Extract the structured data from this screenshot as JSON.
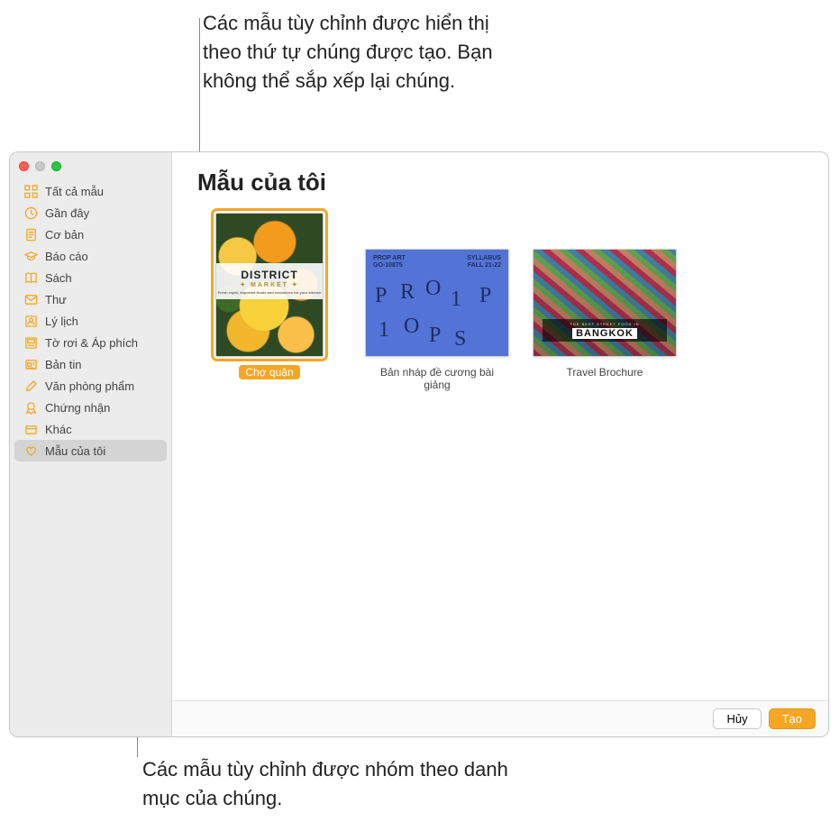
{
  "annotations": {
    "top": "Các mẫu tùy chỉnh được hiển thị theo thứ tự chúng được tạo. Bạn không thể sắp xếp lại chúng.",
    "bottom": "Các mẫu tùy chỉnh được nhóm theo danh mục của chúng."
  },
  "sidebar": {
    "items": [
      {
        "label": "Tất cả mẫu",
        "icon": "grid-icon"
      },
      {
        "label": "Gần đây",
        "icon": "clock-icon"
      },
      {
        "label": "Cơ bản",
        "icon": "doc-icon"
      },
      {
        "label": "Báo cáo",
        "icon": "gradcap-icon"
      },
      {
        "label": "Sách",
        "icon": "book-icon"
      },
      {
        "label": "Thư",
        "icon": "envelope-icon"
      },
      {
        "label": "Lý lịch",
        "icon": "person-icon"
      },
      {
        "label": "Tờ rơi & Áp phích",
        "icon": "poster-icon"
      },
      {
        "label": "Bản tin",
        "icon": "newspaper-icon"
      },
      {
        "label": "Văn phòng phẩm",
        "icon": "pen-icon"
      },
      {
        "label": "Chứng nhận",
        "icon": "ribbon-icon"
      },
      {
        "label": "Khác",
        "icon": "misc-icon"
      },
      {
        "label": "Mẫu của tôi",
        "icon": "heart-icon",
        "selected": true
      }
    ]
  },
  "main": {
    "title": "Mẫu của tôi",
    "templates": [
      {
        "label": "Chợ quận",
        "kind": "district",
        "selected": true,
        "thumb": {
          "line1": "DISTRICT",
          "line2": "MARKET",
          "line3": "Fresh explo, imported foods and exclusives for your kitchen"
        }
      },
      {
        "label": "Bản nháp đề cương bài giảng",
        "kind": "props",
        "landscape": true,
        "thumb": {
          "topLeftA": "PROP ART",
          "topLeftB": "GO-10875",
          "topRightA": "SYLLABUS",
          "topRightB": "FALL 21-22",
          "letters": [
            "P",
            "R",
            "O",
            "1",
            "P",
            "1",
            "O",
            "P",
            "S"
          ]
        }
      },
      {
        "label": "Travel Brochure",
        "kind": "bangkok",
        "landscape": true,
        "thumb": {
          "tag": "THE BEST STREET FOOD IN",
          "city": "BANGKOK"
        }
      }
    ]
  },
  "footer": {
    "cancel": "Hủy",
    "create": "Tạo"
  }
}
